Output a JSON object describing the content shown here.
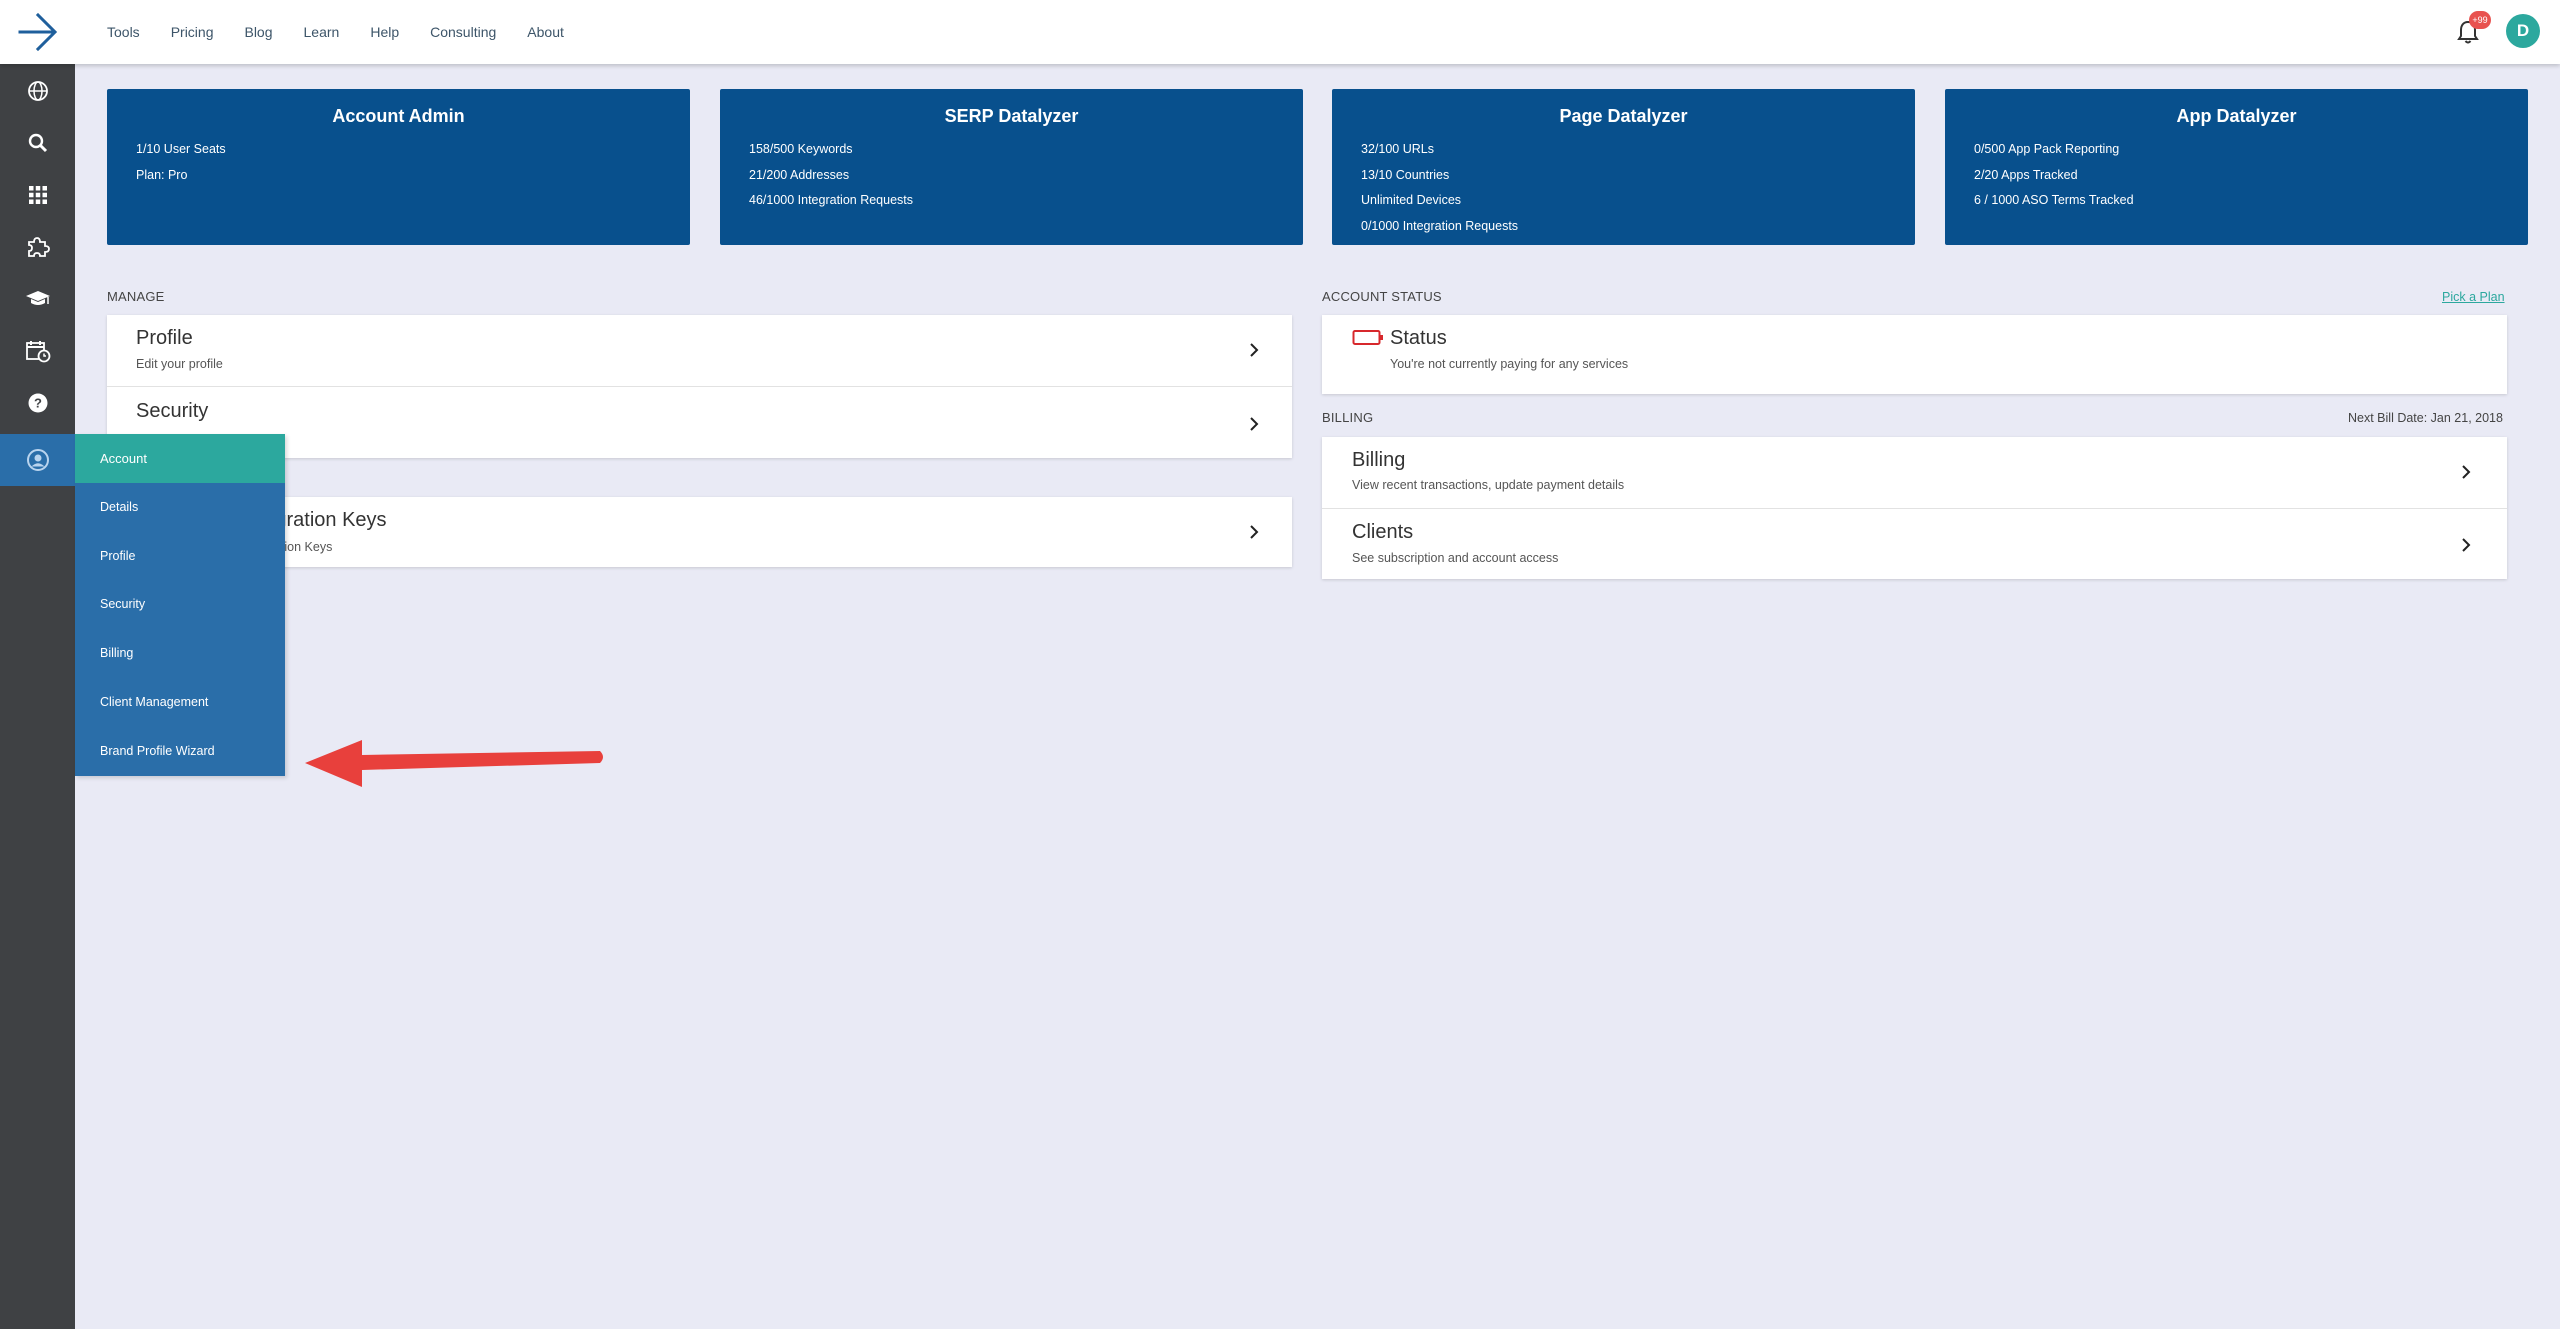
{
  "topnav": {
    "items": [
      "Tools",
      "Pricing",
      "Blog",
      "Learn",
      "Help",
      "Consulting",
      "About"
    ],
    "notification_badge": "+99",
    "avatar_initial": "D"
  },
  "cards": [
    {
      "title": "Account Admin",
      "lines": [
        "1/10 User Seats",
        "Plan: Pro"
      ]
    },
    {
      "title": "SERP Datalyzer",
      "lines": [
        "158/500 Keywords",
        "21/200 Addresses",
        "46/1000 Integration Requests"
      ]
    },
    {
      "title": "Page Datalyzer",
      "lines": [
        "32/100 URLs",
        "13/10 Countries",
        "Unlimited Devices",
        "0/1000 Integration Requests"
      ]
    },
    {
      "title": "App Datalyzer",
      "lines": [
        "0/500 App Pack Reporting",
        "2/20 Apps Tracked",
        "6 / 1000 ASO Terms Tracked"
      ]
    }
  ],
  "manage": {
    "heading": "MANAGE",
    "rows": [
      {
        "title": "Profile",
        "subtitle": "Edit your profile"
      },
      {
        "title": "Security",
        "subtitle": ""
      },
      {
        "title": "Integration Keys",
        "subtitle": "Integration Keys"
      }
    ]
  },
  "account_status": {
    "heading": "ACCOUNT STATUS",
    "action": "Pick a Plan",
    "title": "Status",
    "subtitle": "You're not currently paying for any services"
  },
  "billing": {
    "heading": "BILLING",
    "next_bill": "Next Bill Date: Jan 21, 2018",
    "rows": [
      {
        "title": "Billing",
        "subtitle": "View recent transactions, update payment details"
      },
      {
        "title": "Clients",
        "subtitle": "See subscription and account access"
      }
    ]
  },
  "flyout": {
    "header": "Account",
    "items": [
      "Details",
      "Profile",
      "Security",
      "Billing",
      "Client Management",
      "Brand Profile Wizard"
    ]
  },
  "colors": {
    "card_bg": "#08508d",
    "flyout_bg": "#2a6ea9",
    "accent_teal": "#2ca89e",
    "rail_bg": "#3f4144",
    "page_bg": "#e9eaf5",
    "annotation_arrow": "#e8403c"
  }
}
